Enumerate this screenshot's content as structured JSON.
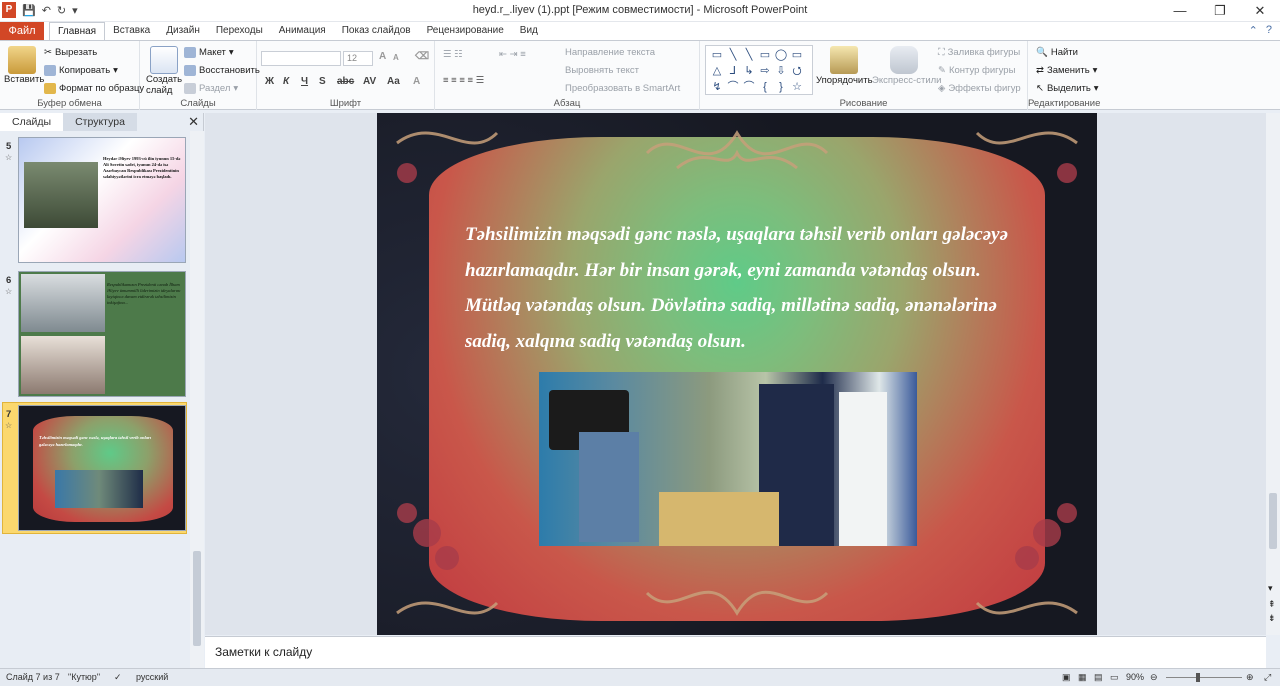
{
  "window": {
    "title": "heyd.r_.liyev (1).ppt [Режим совместимости] - Microsoft PowerPoint",
    "app_icon_letter": "P",
    "controls": [
      "—",
      "❐",
      "✕"
    ]
  },
  "ribbon_tabs": {
    "file": "Файл",
    "tabs": [
      "Главная",
      "Вставка",
      "Дизайн",
      "Переходы",
      "Анимация",
      "Показ слайдов",
      "Рецензирование",
      "Вид"
    ],
    "active": "Главная"
  },
  "clipboard": {
    "group": "Буфер обмена",
    "paste": "Вставить",
    "cut": "Вырезать",
    "copy": "Копировать",
    "format_painter": "Формат по образцу"
  },
  "slides_group": {
    "group": "Слайды",
    "new_slide": "Создать слайд",
    "layout": "Макет",
    "reset": "Восстановить",
    "section": "Раздел"
  },
  "font_group": {
    "group": "Шрифт",
    "font_name": "",
    "font_size": "12"
  },
  "paragraph_group": {
    "group": "Абзац",
    "text_direction": "Направление текста",
    "align_text": "Выровнять текст",
    "smartart": "Преобразовать в SmartArt"
  },
  "drawing_group": {
    "group": "Рисование",
    "arrange": "Упорядочить",
    "quick_styles": "Экспресс-стили",
    "shape_fill": "Заливка фигуры",
    "shape_outline": "Контур фигуры",
    "shape_effects": "Эффекты фигур"
  },
  "editing_group": {
    "group": "Редактирование",
    "find": "Найти",
    "replace": "Заменить",
    "select": "Выделить"
  },
  "panel": {
    "tab_slides": "Слайды",
    "tab_outline": "Структура",
    "close": "✕",
    "thumbs": [
      {
        "num": "5",
        "text": "Heydər Əliyev 1993-cü ilin iyunun 15-də Ali Sovetin sədri, iyunun 24-də isə Azərbaycan Respublikası Prezidentinin səlahiyyətlərini icra etməyə başladı."
      },
      {
        "num": "6",
        "text": "Respublikamızın Prezidenti cənab İlham Əliyev ümummilli liderimizin ideyalarını layiqincə davam etdirərək təhsilimizin inkişafına..."
      },
      {
        "num": "7",
        "text": "Təhsilimizin məqsədi gənc nəslə, uşaqlara təhsil verib onları gələcəyə hazırlamaqdır."
      }
    ]
  },
  "slide": {
    "text": "Təhsilimizin məqsədi gənc nəslə, uşaqlara təhsil verib onları gələcəyə hazırlamaqdır. Hər bir insan gərək, eyni zamanda vətəndaş olsun. Mütləq vətəndaş olsun. Dövlətinə sadiq, millətinə sadiq, ənənələrinə sadiq, xalqına sadiq vətəndaş olsun."
  },
  "notes": {
    "placeholder": "Заметки к слайду"
  },
  "status": {
    "slide_info": "Слайд 7 из 7",
    "theme": "\"Кутюр\"",
    "language": "русский",
    "zoom": "90%"
  }
}
